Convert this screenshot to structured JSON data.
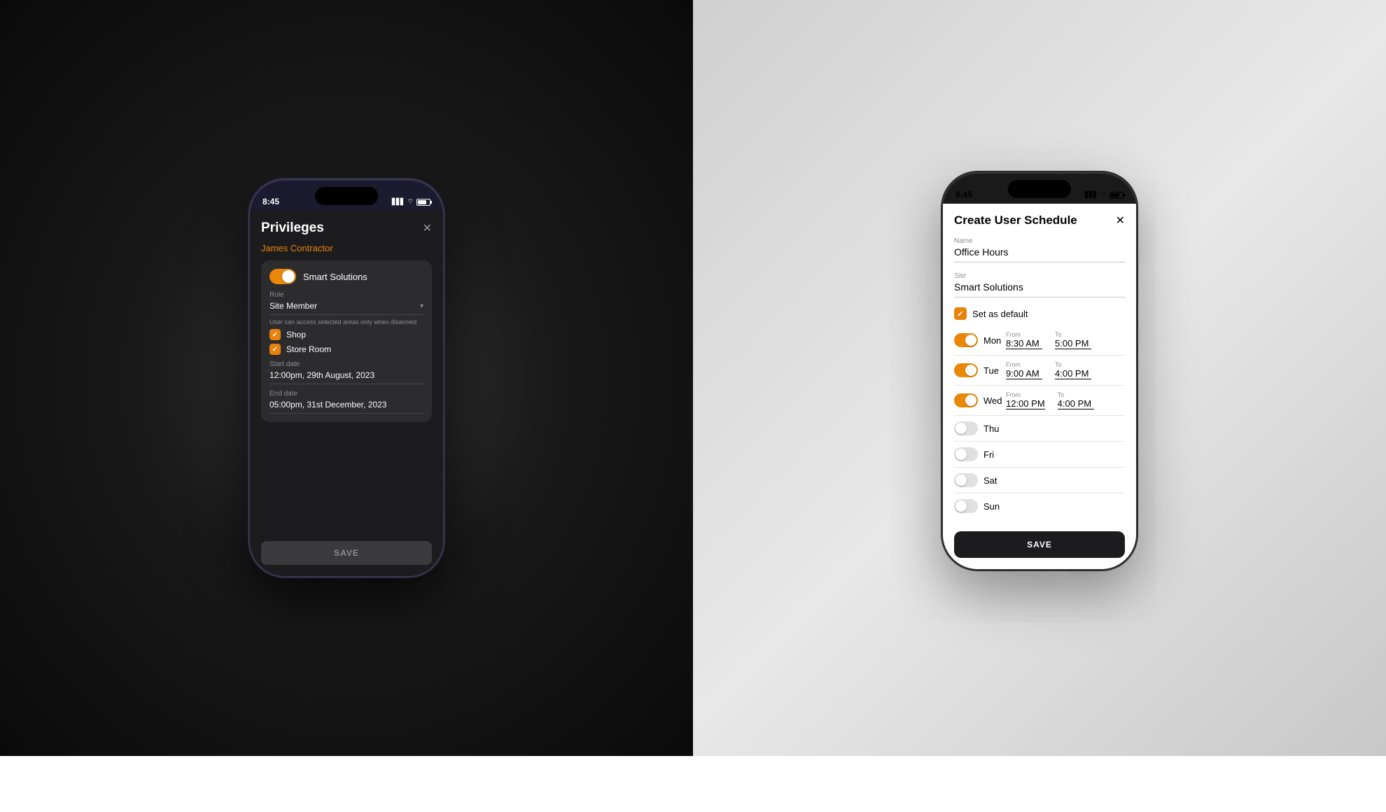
{
  "left": {
    "status": {
      "time": "8:45",
      "signal": "▋▋▋",
      "wifi": "wifi",
      "battery": "battery"
    },
    "screen": {
      "title": "Privileges",
      "close": "✕",
      "user_name": "James Contractor",
      "toggle_site": "Smart Solutions",
      "toggle_on": true,
      "role_label": "Role",
      "role_value": "Site Member",
      "hint": "User can access selected areas only when disarmed",
      "areas": [
        {
          "name": "Shop",
          "checked": true
        },
        {
          "name": "Store Room",
          "checked": true
        }
      ],
      "start_date_label": "Start date",
      "start_date": "12:00pm, 29th August, 2023",
      "end_date_label": "End date",
      "end_date": "05:00pm, 31st December, 2023",
      "save_button": "SAVE"
    }
  },
  "right": {
    "status": {
      "time": "8:45",
      "signal": "▋▋▋",
      "wifi": "wifi",
      "battery": "battery"
    },
    "screen": {
      "title": "Create User Schedule",
      "close": "✕",
      "name_label": "Name",
      "name_value": "Office Hours",
      "site_label": "Site",
      "site_value": "Smart Solutions",
      "set_default_label": "Set as default",
      "schedule": [
        {
          "day": "Mon",
          "enabled": true,
          "from_label": "From",
          "from": "8:30 AM",
          "to_label": "To",
          "to": "5:00 PM"
        },
        {
          "day": "Tue",
          "enabled": true,
          "from_label": "From",
          "from": "9:00 AM",
          "to_label": "To",
          "to": "4:00 PM"
        },
        {
          "day": "Wed",
          "enabled": true,
          "from_label": "From",
          "from": "12:00 PM",
          "to_label": "To",
          "to": "4:00 PM"
        },
        {
          "day": "Thu",
          "enabled": false,
          "from_label": "",
          "from": "",
          "to_label": "",
          "to": ""
        },
        {
          "day": "Fri",
          "enabled": false,
          "from_label": "",
          "from": "",
          "to_label": "",
          "to": ""
        },
        {
          "day": "Sat",
          "enabled": false,
          "from_label": "",
          "from": "",
          "to_label": "",
          "to": ""
        },
        {
          "day": "Sun",
          "enabled": false,
          "from_label": "",
          "from": "",
          "to_label": "",
          "to": ""
        }
      ],
      "save_button": "SAVE"
    }
  }
}
